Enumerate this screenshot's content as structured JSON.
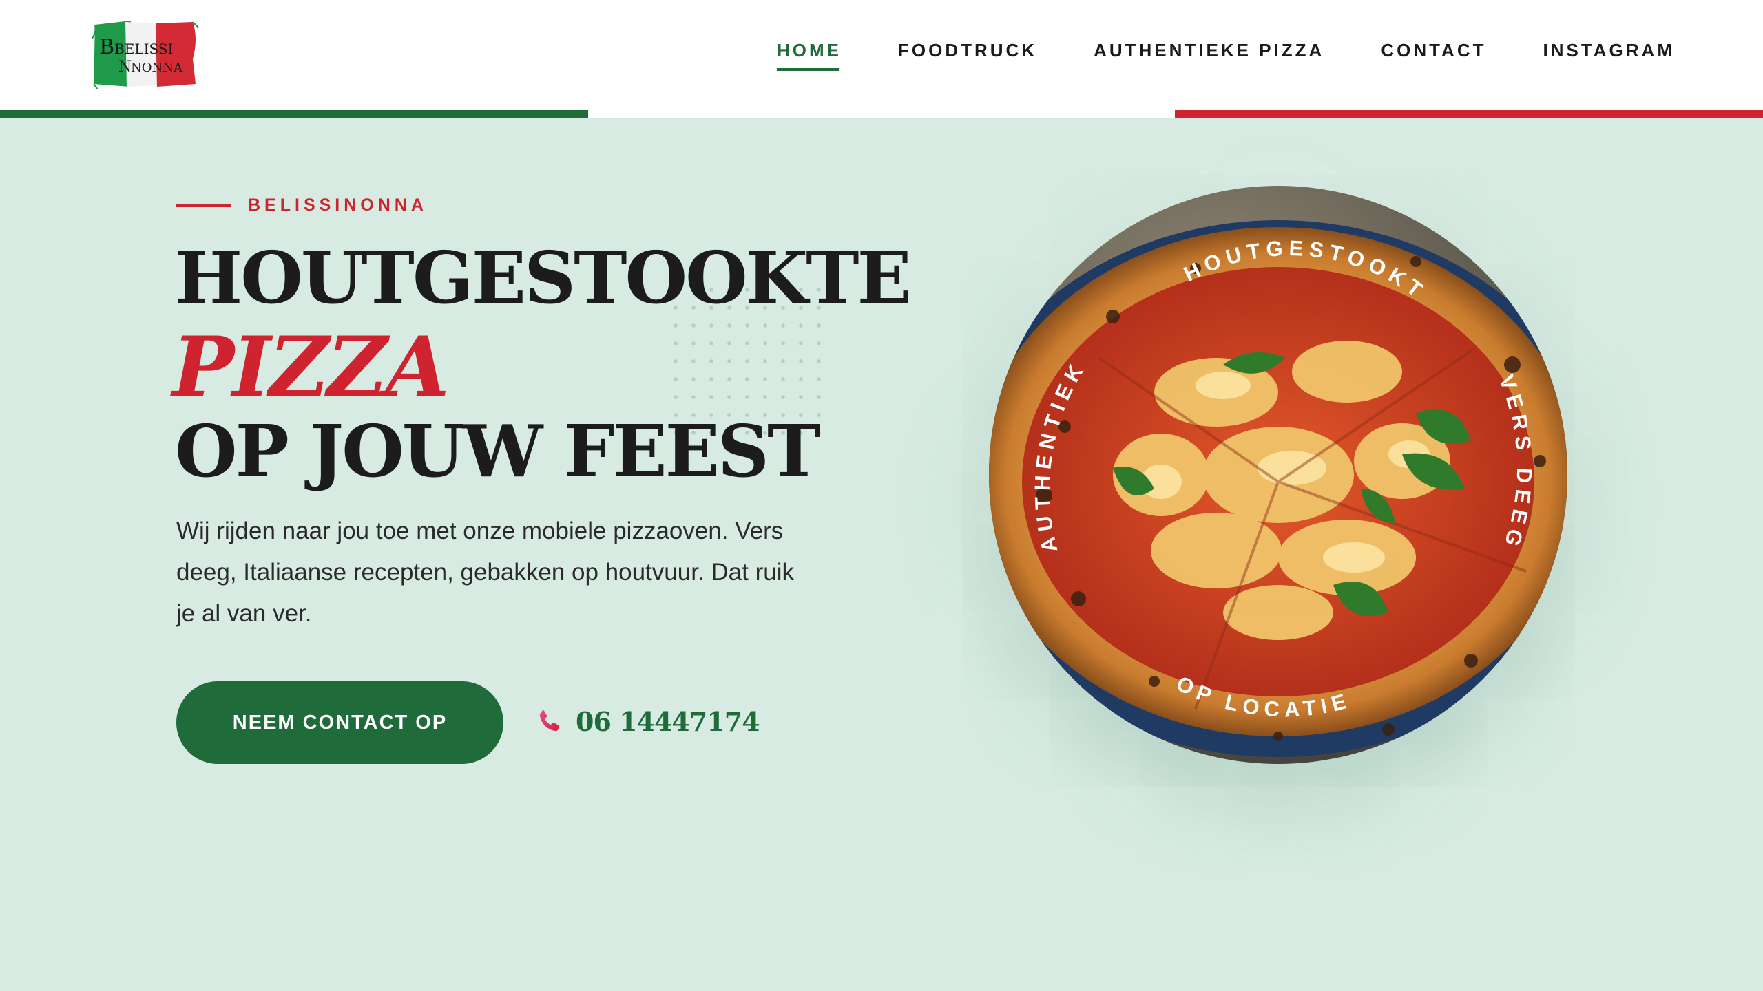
{
  "brand": {
    "logo_line1": "BELISSI",
    "logo_line2": "NONNA",
    "flag_colors": [
      "#1f6b3a",
      "#ffffff",
      "#cf2330"
    ]
  },
  "nav": {
    "items": [
      {
        "label": "HOME",
        "active": true
      },
      {
        "label": "FOODTRUCK",
        "active": false
      },
      {
        "label": "AUTHENTIEKE PIZZA",
        "active": false
      },
      {
        "label": "CONTACT",
        "active": false
      },
      {
        "label": "INSTAGRAM",
        "active": false
      }
    ]
  },
  "hero": {
    "eyebrow": "BELISSINONNA",
    "headline_line1": "HOUTGESTOOKTE",
    "headline_line2": "PIZZA",
    "headline_line3": "OP JOUW FEEST",
    "lead": "Wij rijden naar jou toe met onze mobiele pizzaoven. Vers deeg, Italiaanse recepten, gebakken op houtvuur. Dat ruik je al van ver.",
    "cta_label": "NEEM CONTACT OP",
    "phone_number": "06 14447174",
    "phone_icon": "phone-icon"
  },
  "badge": {
    "top": "HOUTGESTOOKT",
    "right": "VERS DEEG",
    "bottom": "OP LOCATIE",
    "left": "AUTHENTIEK"
  },
  "colors": {
    "background": "#d7ebe2",
    "green": "#1f6b3a",
    "red": "#cf2330",
    "text": "#1c1c1c"
  }
}
